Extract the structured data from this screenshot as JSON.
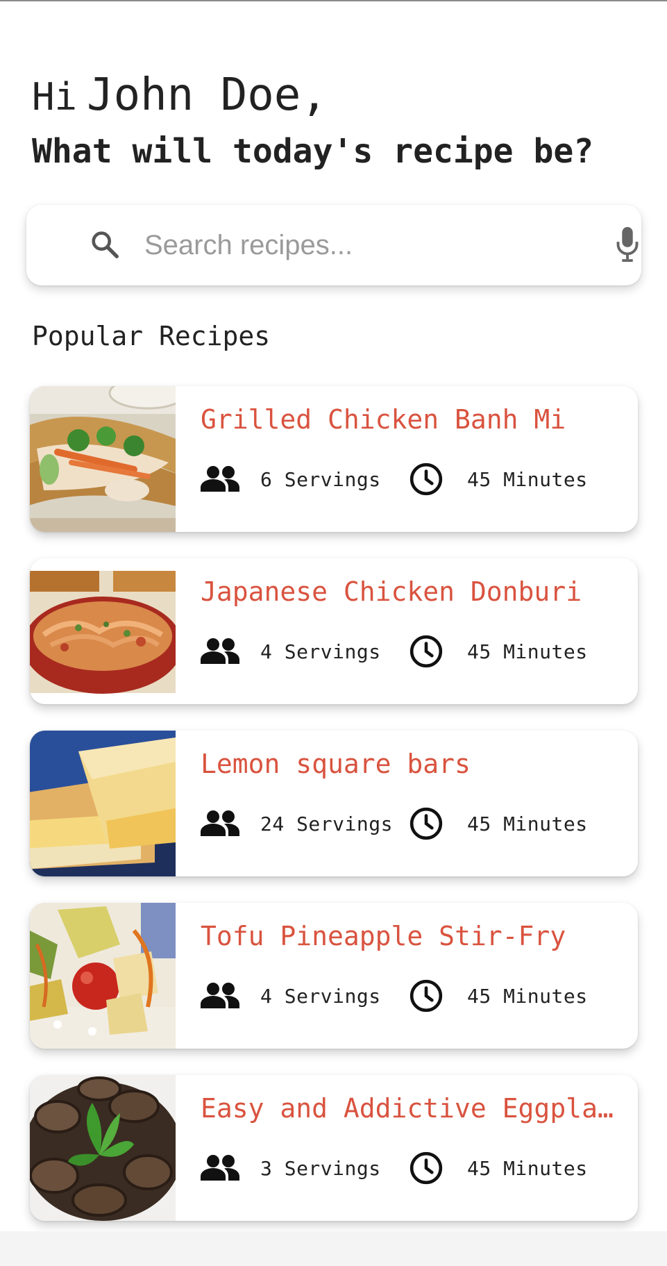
{
  "header": {
    "greeting": "Hi",
    "user_name": "John Doe,",
    "question": "What will today's recipe be?"
  },
  "search": {
    "placeholder": "Search recipes...",
    "value": ""
  },
  "section": {
    "title": "Popular Recipes"
  },
  "recipes": [
    {
      "title": "Grilled Chicken Banh Mi",
      "servings": "6 Servings",
      "time": "45 Minutes"
    },
    {
      "title": "Japanese Chicken Donburi",
      "servings": "4 Servings",
      "time": "45 Minutes"
    },
    {
      "title": "Lemon square bars",
      "servings": "24 Servings",
      "time": "45 Minutes"
    },
    {
      "title": "Tofu Pineapple Stir-Fry",
      "servings": "4 Servings",
      "time": "45 Minutes"
    },
    {
      "title": "Easy and Addictive Eggplan…",
      "servings": "3 Servings",
      "time": "45 Minutes"
    }
  ],
  "icons": {
    "search": "search-icon",
    "mic": "mic-icon",
    "servings": "people-icon",
    "time": "clock-icon"
  },
  "colors": {
    "accent": "#d9533f",
    "text": "#222222",
    "placeholder": "#9a9a9a"
  }
}
